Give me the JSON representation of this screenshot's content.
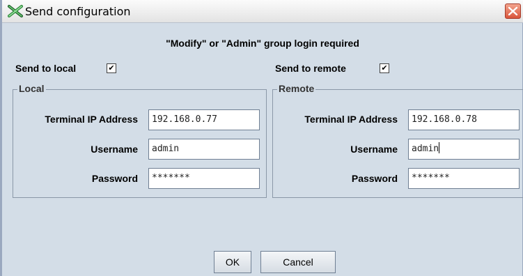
{
  "window": {
    "title": "Send configuration"
  },
  "notice": "\"Modify\" or \"Admin\" group login required",
  "send_local": {
    "label": "Send to local",
    "checked": true
  },
  "send_remote": {
    "label": "Send to remote",
    "checked": true
  },
  "local": {
    "legend": "Local",
    "ip_label": "Terminal IP Address",
    "ip_value": "192.168.0.77",
    "user_label": "Username",
    "user_value": "admin",
    "pass_label": "Password",
    "pass_value": "*******"
  },
  "remote": {
    "legend": "Remote",
    "ip_label": "Terminal IP Address",
    "ip_value": "192.168.0.78",
    "user_label": "Username",
    "user_value": "admin",
    "pass_label": "Password",
    "pass_value": "*******"
  },
  "buttons": {
    "ok": "OK",
    "cancel": "Cancel"
  },
  "colors": {
    "dialog_bg": "#d3dde7",
    "close_red": "#d9553b"
  },
  "icons": {
    "app": "tools-cross-icon",
    "close": "close-icon",
    "check": "check-icon"
  }
}
